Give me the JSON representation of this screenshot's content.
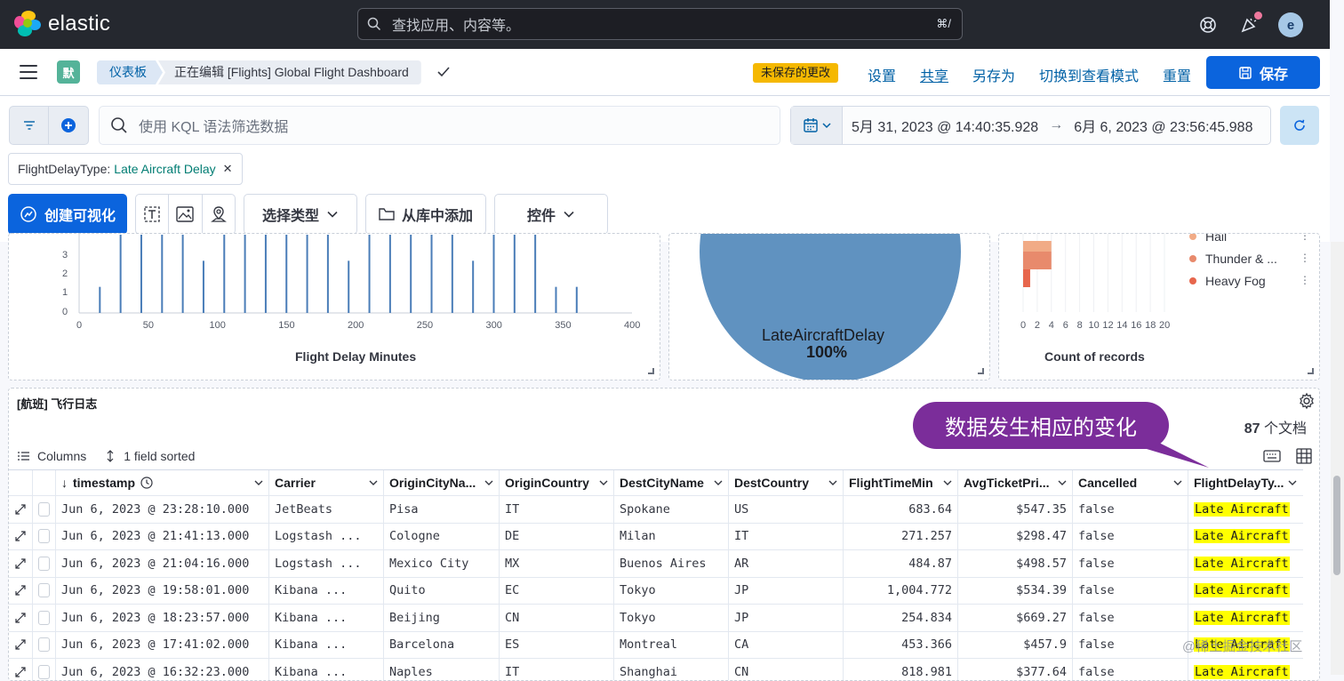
{
  "topbar": {
    "brand": "elastic",
    "search_placeholder": "查找应用、内容等。",
    "search_shortcut": "⌘/",
    "avatar_letter": "e"
  },
  "navbar": {
    "space_badge": "默",
    "breadcrumb_root": "仪表板",
    "breadcrumb_current": "正在编辑 [Flights] Global Flight Dashboard",
    "unsaved_badge": "未保存的更改",
    "links": [
      "设置",
      "共享",
      "另存为",
      "切换到查看模式",
      "重置"
    ],
    "save_label": "保存"
  },
  "query": {
    "kql_placeholder": "使用 KQL 语法筛选数据",
    "date_start": "5月 31, 2023 @ 14:40:35.928",
    "date_arrow": "→",
    "date_end": "6月 6, 2023 @ 23:56:45.988",
    "filter_pill_key": "FlightDelayType:",
    "filter_pill_value": "Late Aircraft Delay",
    "create_visualization": "创建可视化",
    "select_type": "选择类型",
    "add_from_library": "从库中添加",
    "controls": "控件"
  },
  "charts": {
    "histogram": {
      "xlabel": "Flight Delay Minutes",
      "y_ticks": [
        "3",
        "2",
        "1",
        "0"
      ],
      "x_ticks": [
        "0",
        "50",
        "100",
        "150",
        "200",
        "250",
        "300",
        "350",
        "400"
      ]
    },
    "pie": {
      "label": "LateAircraftDelay",
      "percent": "100%"
    },
    "bar": {
      "xlabel": "Count of records",
      "x_ticks": [
        "0",
        "2",
        "4",
        "6",
        "8",
        "10",
        "12",
        "14",
        "16",
        "18",
        "20"
      ],
      "legend": [
        "Hail",
        "Thunder & ...",
        "Heavy Fog"
      ]
    }
  },
  "chart_data": [
    {
      "type": "bar",
      "xlabel": "Flight Delay Minutes",
      "ylabel": "",
      "x": [
        15,
        30,
        45,
        60,
        75,
        90,
        105,
        120,
        135,
        150,
        165,
        180,
        195,
        210,
        225,
        240,
        255,
        270,
        285,
        300,
        315,
        330,
        345,
        360
      ],
      "values": [
        1,
        3,
        3,
        3,
        3,
        2,
        3,
        3,
        3,
        3,
        3,
        3,
        2,
        3,
        3,
        3,
        3,
        3,
        2,
        3,
        3,
        3,
        1,
        1
      ],
      "xlim": [
        0,
        400
      ],
      "ylim": [
        0,
        3
      ]
    },
    {
      "type": "pie",
      "labels": [
        "LateAircraftDelay"
      ],
      "values": [
        100
      ]
    },
    {
      "type": "bar",
      "orientation": "horizontal",
      "xlabel": "Count of records",
      "xlim": [
        0,
        20
      ],
      "categories": [
        "Hail",
        "Thunder & ...",
        "Heavy Fog"
      ],
      "values": [
        4,
        4,
        1
      ]
    }
  ],
  "table": {
    "title": "[航班] 飞行日志",
    "doc_count": "87",
    "doc_count_suffix": "个文档",
    "columns_label": "Columns",
    "sorted_label": "1 field sorted",
    "callout": "数据发生相应的变化",
    "headers": [
      "timestamp",
      "Carrier",
      "OriginCityNa...",
      "OriginCountry",
      "DestCityName",
      "DestCountry",
      "FlightTimeMin",
      "AvgTicketPri...",
      "Cancelled",
      "FlightDelayTy..."
    ],
    "rows": [
      [
        "Jun 6, 2023 @ 23:28:10.000",
        "JetBeats",
        "Pisa",
        "IT",
        "Spokane",
        "US",
        "683.64",
        "$547.35",
        "false",
        "Late Aircraft"
      ],
      [
        "Jun 6, 2023 @ 21:41:13.000",
        "Logstash ...",
        "Cologne",
        "DE",
        "Milan",
        "IT",
        "271.257",
        "$298.47",
        "false",
        "Late Aircraft"
      ],
      [
        "Jun 6, 2023 @ 21:04:16.000",
        "Logstash ...",
        "Mexico City",
        "MX",
        "Buenos Aires",
        "AR",
        "484.87",
        "$498.57",
        "false",
        "Late Aircraft"
      ],
      [
        "Jun 6, 2023 @ 19:58:01.000",
        "Kibana ...",
        "Quito",
        "EC",
        "Tokyo",
        "JP",
        "1,004.772",
        "$534.39",
        "false",
        "Late Aircraft"
      ],
      [
        "Jun 6, 2023 @ 18:23:57.000",
        "Kibana ...",
        "Beijing",
        "CN",
        "Tokyo",
        "JP",
        "254.834",
        "$669.27",
        "false",
        "Late Aircraft"
      ],
      [
        "Jun 6, 2023 @ 17:41:02.000",
        "Kibana ...",
        "Barcelona",
        "ES",
        "Montreal",
        "CA",
        "453.366",
        "$457.9",
        "false",
        "Late Aircraft"
      ],
      [
        "Jun 6, 2023 @ 16:32:23.000",
        "Kibana ...",
        "Naples",
        "IT",
        "Shanghai",
        "CN",
        "818.981",
        "$377.64",
        "false",
        "Late Aircraft"
      ]
    ]
  },
  "watermark": "@稀土掘金技术社区",
  "colors": {
    "accent": "#0b64dd",
    "pie": "#6092c0",
    "callout": "#7b2d9a",
    "highlight": "#ffff00"
  }
}
